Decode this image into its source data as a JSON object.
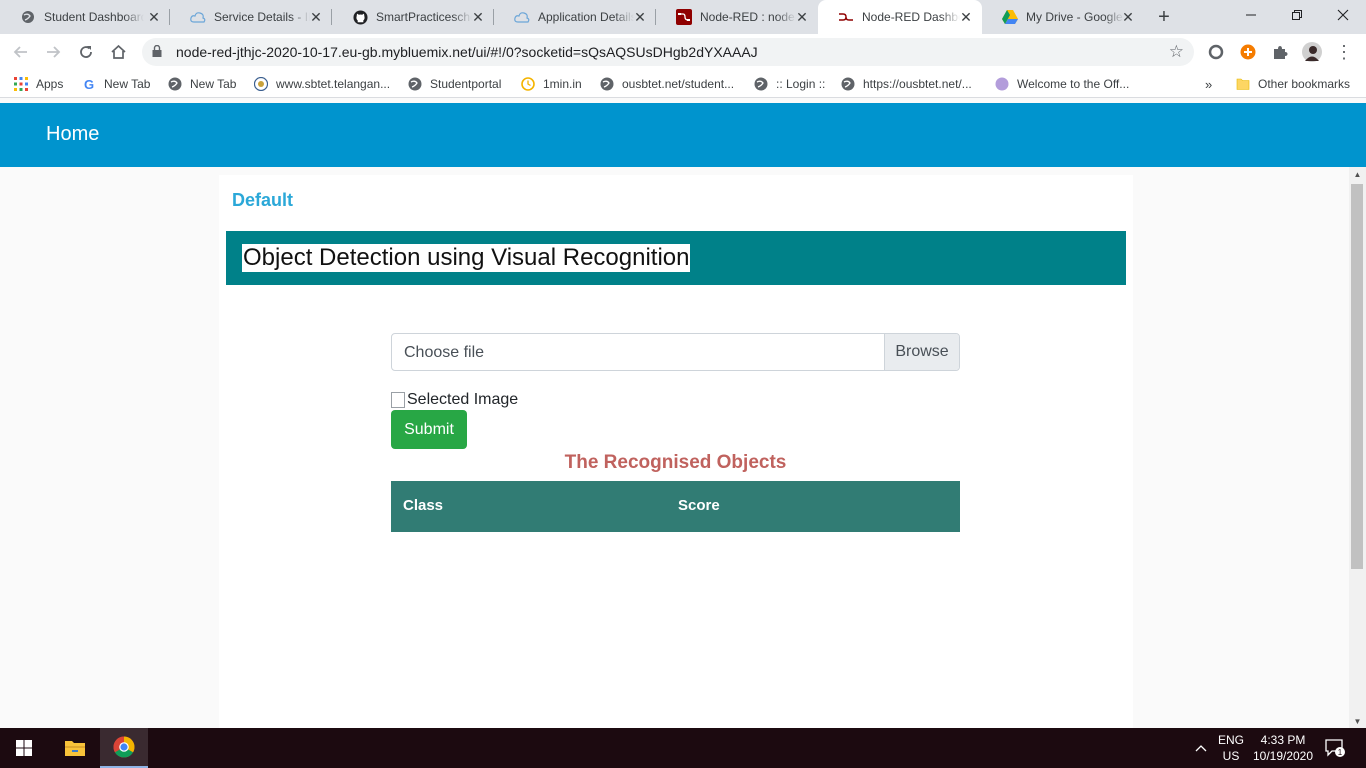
{
  "browser": {
    "tabs": [
      {
        "title": "Student Dashboard",
        "icon": "globe-icon",
        "active": false
      },
      {
        "title": "Service Details - IBM",
        "icon": "cloud-icon",
        "active": false
      },
      {
        "title": "SmartPracticeschool",
        "icon": "github-icon",
        "active": false
      },
      {
        "title": "Application Details",
        "icon": "cloud-icon",
        "active": false
      },
      {
        "title": "Node-RED : node-red",
        "icon": "node-red-icon",
        "active": false
      },
      {
        "title": "Node-RED Dashboard",
        "icon": "node-red-icon",
        "active": true
      },
      {
        "title": "My Drive - Google Drive",
        "icon": "drive-icon",
        "active": false
      }
    ],
    "url": "node-red-jthjc-2020-10-17.eu-gb.mybluemix.net/ui/#!/0?socketid=sQsAQSUsDHgb2dYXAAAJ",
    "bookmarks": [
      {
        "label": "Apps",
        "icon": "apps-grid-icon"
      },
      {
        "label": "New Tab",
        "icon": "google-icon"
      },
      {
        "label": "New Tab",
        "icon": "globe-icon"
      },
      {
        "label": "www.sbtet.telangan...",
        "icon": "emblem-icon"
      },
      {
        "label": "Studentportal",
        "icon": "globe-icon"
      },
      {
        "label": "1min.in",
        "icon": "clock-icon"
      },
      {
        "label": "ousbtet.net/student...",
        "icon": "globe-icon"
      },
      {
        "label": ":: Login ::",
        "icon": "globe-icon"
      },
      {
        "label": "https://ousbtet.net/...",
        "icon": "globe-icon"
      },
      {
        "label": "Welcome to the Off...",
        "icon": "circle-icon"
      }
    ],
    "overflow_label": "»",
    "other_bookmarks": "Other bookmarks"
  },
  "app": {
    "header_title": "Home",
    "group_title": "Default",
    "banner_title": "Object Detection using Visual Recognition",
    "file_placeholder": "Choose file",
    "browse_label": "Browse",
    "image_alt": "Selected Image",
    "submit_label": "Submit",
    "results_heading": "The Recognised Objects",
    "table_columns": [
      "Class",
      "Score"
    ]
  },
  "taskbar": {
    "lang_line1": "ENG",
    "lang_line2": "US",
    "time": "4:33 PM",
    "date": "10/19/2020",
    "notification_count": "1"
  },
  "colors": {
    "app_bar": "#0094ce",
    "banner": "#008189",
    "submit": "#28a745",
    "table_header": "#317c74",
    "results_heading": "#c0625e"
  }
}
